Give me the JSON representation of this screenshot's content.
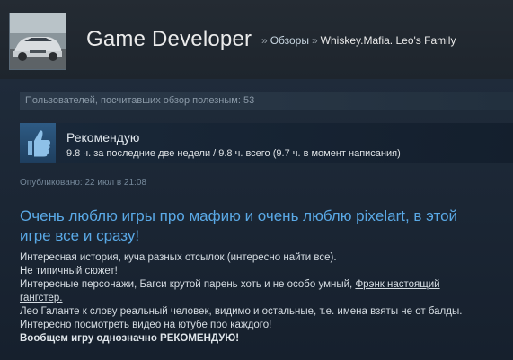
{
  "header": {
    "profile_name": "Game Developer",
    "breadcrumb": {
      "separator": "»",
      "section": "Обзоры",
      "game": "Whiskey.Mafia. Leo's Family"
    }
  },
  "review": {
    "helpful_count_text": "Пользователей, посчитавших обзор полезным: 53",
    "verdict": "Рекомендую",
    "hours_text": "9.8 ч. за последние две недели / 9.8 ч. всего (9.7 ч. в момент написания)",
    "posted_text": "Опубликовано: 22 июл в 21:08",
    "title_line1": "Очень люблю игры про мафию и очень люблю pixelart, в этой",
    "title_line2": "игре все и сразу!",
    "body": {
      "line1": "Интересная история, куча разных отсылок (интересно найти все).",
      "line2": "Не типичный сюжет!",
      "line3_prefix": "Интересные персонажи, Багси крутой парень хоть и не особо умный, ",
      "line3_link_part1": "Фрэнк настоящий",
      "line3_link_part2": "гангстер.",
      "line4": "Лео Галанте к слову реальный человек, видимо и остальные, т.е. имена взяты не от балды.",
      "line5": "Интересно посмотреть видео на ютубе про каждого!",
      "line6": "Вообщем игру однозначно РЕКОМЕНДУЮ!"
    }
  },
  "icons": {
    "avatar": "car-photo",
    "verdict_icon": "thumbs-up-icon"
  },
  "colors": {
    "background": "#1b2838",
    "title_blue": "#5aa9e6",
    "thumb_box": "#2e5b84"
  }
}
